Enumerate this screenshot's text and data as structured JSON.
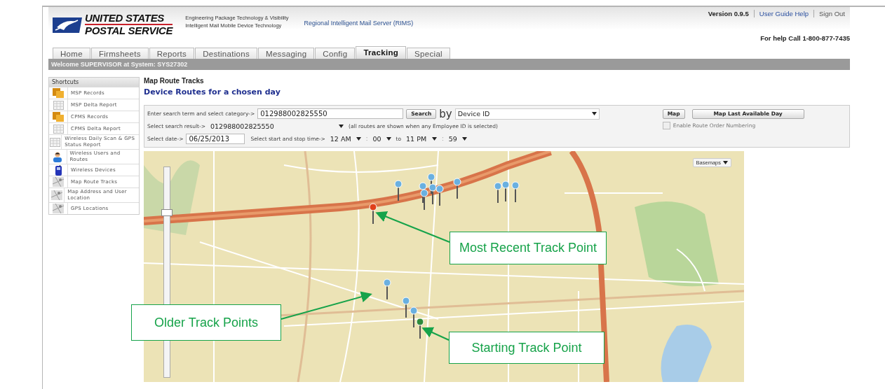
{
  "header": {
    "logo_line_1": "UNITED STATES",
    "logo_line_2": "POSTAL SERVICE",
    "subtitle_1": "Engineering Package Technology & Visibility",
    "subtitle_2": "Intelligent Mail Mobile Device Technology",
    "system_name": "Regional Intelligent Mail Server (RIMS)",
    "version": "Version 0.9.5",
    "links": [
      "User Guide Help",
      "Sign Out"
    ],
    "help_phone": "For help Call 1-800-877-7435"
  },
  "tabs": [
    {
      "label": "Home",
      "selected": false
    },
    {
      "label": "Firmsheets",
      "selected": false
    },
    {
      "label": "Reports",
      "selected": false
    },
    {
      "label": "Destinations",
      "selected": false
    },
    {
      "label": "Messaging",
      "selected": false
    },
    {
      "label": "Config",
      "selected": false
    },
    {
      "label": "Tracking",
      "selected": true
    },
    {
      "label": "Special",
      "selected": false
    }
  ],
  "welcome": "Welcome SUPERVISOR at System: SYS27302",
  "sidebar": {
    "title": "Shortcuts",
    "items": [
      {
        "label": "MSP Records",
        "kind": "records"
      },
      {
        "label": "MSP Delta Report",
        "kind": "report"
      },
      {
        "label": "CPMS Records",
        "kind": "records"
      },
      {
        "label": "CPMS Delta Report",
        "kind": "report"
      },
      {
        "label": "Wireless Daily Scan & GPS Status Report",
        "kind": "report"
      },
      {
        "label": "Wireless Users and Routes",
        "kind": "user"
      },
      {
        "label": "Wireless Devices",
        "kind": "device"
      },
      {
        "label": "Map Route Tracks",
        "kind": "map"
      },
      {
        "label": "Map Address and User Location",
        "kind": "map"
      },
      {
        "label": "GPS Locations",
        "kind": "map"
      }
    ]
  },
  "page": {
    "title": "Map Route Tracks",
    "subtitle": "Device Routes for a chosen day"
  },
  "form": {
    "search_label": "Enter search term and select category->",
    "search_value": "012988002825550",
    "search_button": "Search",
    "by_label": "by",
    "category": "Device ID",
    "map_button": "Map",
    "last_day_button": "Map Last Available Day",
    "result_label": "Select search result->",
    "result_value": "012988002825550",
    "result_note": "(all routes are shown when any Employee ID is selected)",
    "route_numbering": {
      "label": "Enable Route Order Numbering",
      "checked": false
    },
    "date_label": "Select date->",
    "date_value": "06/25/2013",
    "time_label": "Select start and stop time->",
    "start_hour": "12 AM",
    "colons": [
      ":",
      ":"
    ],
    "start_minute": "00",
    "to_label": "to",
    "end_hour": "11 PM",
    "end_minute": "59"
  },
  "map": {
    "basemaps_button": "Basemaps",
    "zoom": {
      "level": 0.8
    },
    "track_points": [
      {
        "kind": "older"
      },
      {
        "kind": "older"
      },
      {
        "kind": "older"
      },
      {
        "kind": "older"
      },
      {
        "kind": "older"
      },
      {
        "kind": "older"
      },
      {
        "kind": "older"
      },
      {
        "kind": "older"
      },
      {
        "kind": "older"
      },
      {
        "kind": "older"
      },
      {
        "kind": "older"
      },
      {
        "kind": "older"
      },
      {
        "kind": "older"
      },
      {
        "kind": "recent"
      },
      {
        "kind": "start"
      }
    ],
    "callouts": [
      "Most Recent Track Point",
      "Older Track Points",
      "Starting Track Point"
    ]
  }
}
